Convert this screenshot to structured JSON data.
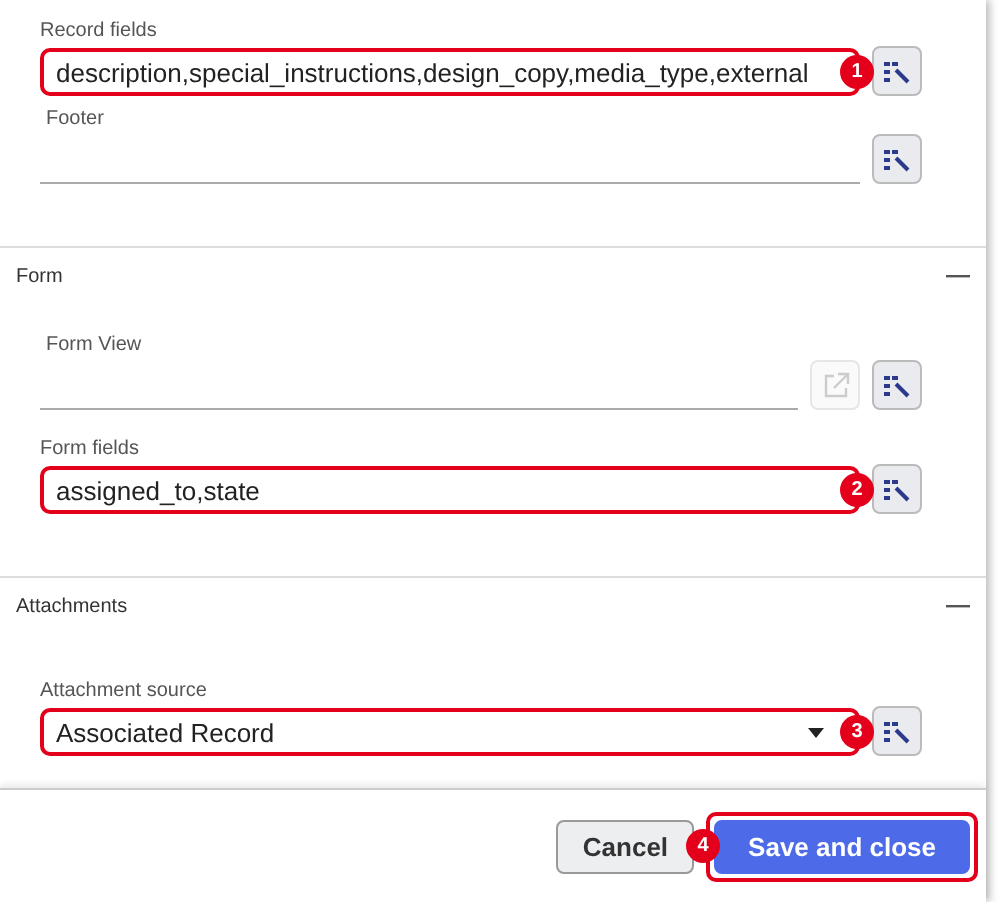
{
  "sections": [
    {
      "kind": "plain",
      "fields": [
        {
          "label": "Record fields",
          "kind": "text",
          "value": "description,special_instructions,design_copy,media_type,external",
          "callout": "1"
        },
        {
          "label": "Footer",
          "kind": "text"
        }
      ]
    },
    {
      "kind": "collapsible",
      "title": "Form",
      "expanded": true,
      "fields": [
        {
          "label": "Form View",
          "kind": "text",
          "open_link": {
            "disabled": true
          }
        },
        {
          "label": "Form fields",
          "kind": "text",
          "value": "assigned_to,state",
          "callout": "2"
        }
      ]
    },
    {
      "kind": "collapsible",
      "title": "Attachments",
      "expanded": true,
      "fields": [
        {
          "label": "Attachment source",
          "kind": "select",
          "value": "Associated Record",
          "callout": "3"
        }
      ]
    }
  ],
  "buttons": [
    {
      "label": "Cancel",
      "kind": "secondary"
    },
    {
      "label": "Save and close",
      "kind": "primary",
      "callout": "4"
    }
  ]
}
